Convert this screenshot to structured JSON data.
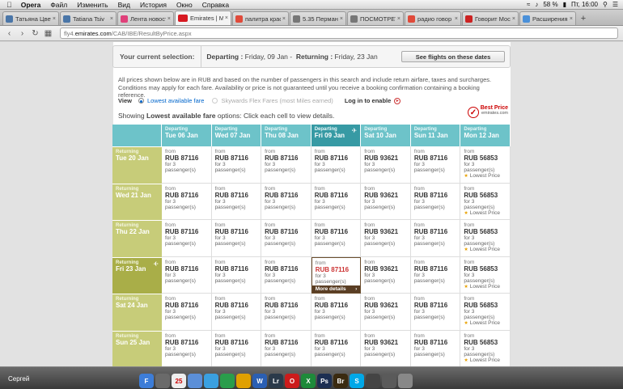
{
  "menubar": {
    "apple": "",
    "items": [
      "Opera",
      "Файл",
      "Изменить",
      "Вид",
      "История",
      "Окно",
      "Справка"
    ],
    "battery": "58 %",
    "clock": "Пт, 16:00"
  },
  "tabs": [
    {
      "title": "Татьяна Цвет",
      "fav_color": "#4a76a8",
      "fav_icon": "vk"
    },
    {
      "title": "Tatiana Tsiv",
      "fav_color": "#4a76a8",
      "fav_icon": "vk"
    },
    {
      "title": "Лента новост",
      "fav_color": "#e0407a",
      "fav_icon": "b"
    },
    {
      "title": "Emirates | Ма",
      "fav_color": "#d71921",
      "fav_icon": "EK"
    },
    {
      "title": "палитра крас",
      "fav_color": "#e04a3a",
      "fav_icon": "Я"
    },
    {
      "title": "5.35 Перман",
      "fav_color": "#777777",
      "fav_icon": "doc"
    },
    {
      "title": "ПОСМОТРЕТ",
      "fav_color": "#777777",
      "fav_icon": "doc"
    },
    {
      "title": "радио говор",
      "fav_color": "#e04a3a",
      "fav_icon": "Я"
    },
    {
      "title": "Говорит Моск",
      "fav_color": "#cc2222",
      "fav_icon": "gm"
    },
    {
      "title": "Расширения",
      "fav_color": "#4a90d9",
      "fav_icon": "ext"
    }
  ],
  "address": {
    "prefix": "fly4.",
    "host": "emirates.com",
    "path": "/CAB/IBE/ResultByPrice.aspx"
  },
  "selection": {
    "label": "Your current selection:",
    "departing_label": "Departing :",
    "departing_value": "Friday, 09 Jan -",
    "returning_label": "Returning :",
    "returning_value": "Friday, 23 Jan",
    "see_button": "See flights on these dates"
  },
  "info_text": "All prices shown below are in RUB and based on the number of passengers in this search and include return airfare, taxes and surcharges. Conditions may apply for each fare. Availability or price is not guaranteed until you receive a booking confirmation containing a booking reference.",
  "view": {
    "label": "View",
    "option1": "Lowest available fare",
    "option2": "Skywards Flex Fares (most Miles earned)",
    "login": "Log in to enable"
  },
  "showing": {
    "pre": "Showing ",
    "bold": "Lowest available fare",
    "post": " options: Click each cell to view details."
  },
  "best_price": {
    "line1": "Best Price",
    "line2": "emirates.com"
  },
  "grid": {
    "dep_sub": "Departing",
    "ret_sub": "Returning",
    "columns": [
      "Tue 06 Jan",
      "Wed 07 Jan",
      "Thu 08 Jan",
      "Fri 09 Jan",
      "Sat 10 Jan",
      "Sun 11 Jan",
      "Mon 12 Jan"
    ],
    "rows": [
      "Tue 20 Jan",
      "Wed 21 Jan",
      "Thu 22 Jan",
      "Fri 23 Jan",
      "Sat 24 Jan",
      "Sun 25 Jan"
    ],
    "selected_col": 3,
    "selected_row": 3,
    "from": "from",
    "pax": "for 3 passenger(s)",
    "lowest": "Lowest Price",
    "more": "More details",
    "prices": [
      "RUB 87116",
      "RUB 87116",
      "RUB 87116",
      "RUB 87116",
      "RUB 93621",
      "RUB 87116",
      "RUB 56853"
    ],
    "lowest_col": 6
  },
  "dock": {
    "user": "Сергей",
    "icons": [
      {
        "label": "F",
        "color": "#3d7dd8"
      },
      {
        "label": "",
        "color": "#6a6a6a"
      },
      {
        "label": "25",
        "color": "#eeeeee"
      },
      {
        "label": "",
        "color": "#5b8fd8"
      },
      {
        "label": "",
        "color": "#3aa0e0"
      },
      {
        "label": "",
        "color": "#2a9d4b"
      },
      {
        "label": "",
        "color": "#e0a000"
      },
      {
        "label": "W",
        "color": "#2b5fb3"
      },
      {
        "label": "Lr",
        "color": "#2b3a4a"
      },
      {
        "label": "O",
        "color": "#cc1b1b"
      },
      {
        "label": "X",
        "color": "#1e8a3a"
      },
      {
        "label": "Ps",
        "color": "#1d2f52"
      },
      {
        "label": "Br",
        "color": "#3a2a10"
      },
      {
        "label": "S",
        "color": "#00a8e8"
      },
      {
        "label": "",
        "color": "#444444"
      },
      {
        "label": "",
        "color": "#5a5a5a"
      },
      {
        "label": "",
        "color": "#888888"
      }
    ]
  }
}
